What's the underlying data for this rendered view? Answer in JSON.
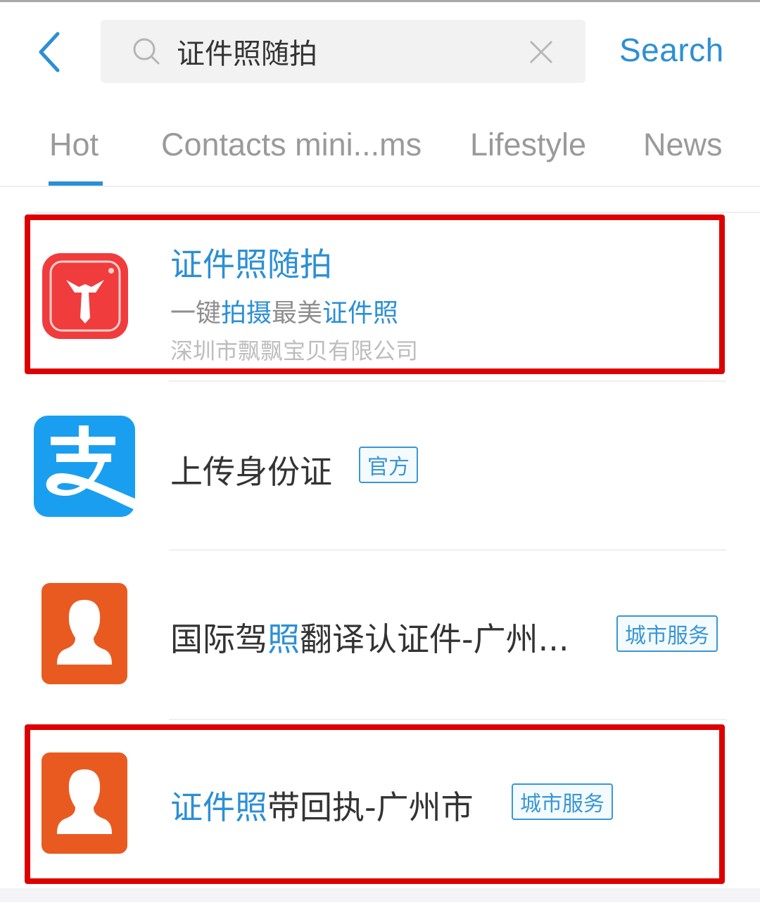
{
  "header": {
    "back_icon": "chevron-left-icon",
    "search_icon": "search-icon",
    "search_value": "证件照随拍",
    "clear_icon": "close-icon",
    "search_action_label": "Search"
  },
  "tabs": [
    {
      "label": "Hot",
      "active": true
    },
    {
      "label": "Contacts mini...ms",
      "active": false
    },
    {
      "label": "Lifestyle",
      "active": false
    },
    {
      "label": "News",
      "active": false
    }
  ],
  "colors": {
    "accent": "#2b8fd6",
    "highlight_frame": "#dd0000",
    "alipay_blue": "#1a9ff0",
    "city_service_orange": "#e95a21",
    "app_red": "#f03c3c"
  },
  "results": [
    {
      "icon": "tie-camera-app-icon",
      "title_parts": [
        {
          "text": "证件照随拍",
          "hl": true
        }
      ],
      "subtitle_parts": [
        {
          "text": "一键",
          "hl": false
        },
        {
          "text": "拍摄",
          "hl": true
        },
        {
          "text": "最美",
          "hl": false
        },
        {
          "text": "证件照",
          "hl": true
        }
      ],
      "company": "深圳市飘飘宝贝有限公司",
      "highlighted": true
    },
    {
      "icon": "alipay-icon",
      "title_parts": [
        {
          "text": "上传身份证",
          "hl": false
        }
      ],
      "badge": "官方",
      "highlighted": false
    },
    {
      "icon": "person-silhouette-icon",
      "title_parts": [
        {
          "text": "国际驾",
          "hl": false
        },
        {
          "text": "照",
          "hl": true
        },
        {
          "text": "翻译认证件-广州...",
          "hl": false
        }
      ],
      "badge": "城市服务",
      "highlighted": false
    },
    {
      "icon": "person-silhouette-icon",
      "title_parts": [
        {
          "text": "证件照",
          "hl": true
        },
        {
          "text": "带回执-广州市",
          "hl": false
        }
      ],
      "badge": "城市服务",
      "highlighted": true
    }
  ]
}
